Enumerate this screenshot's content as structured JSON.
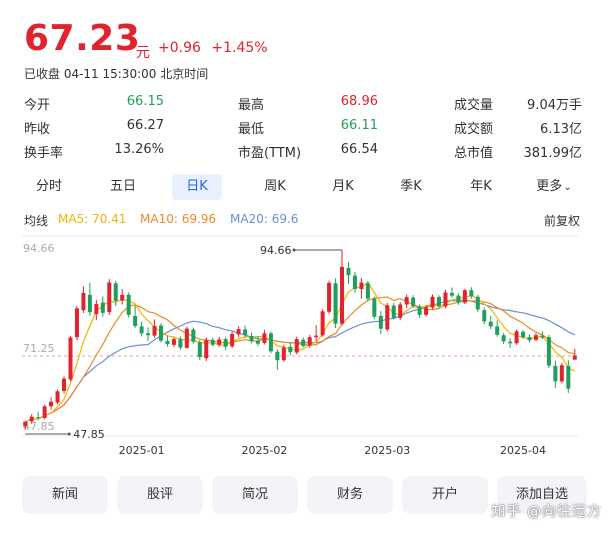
{
  "quote": {
    "price": "67.23",
    "unit": "元",
    "change": "+0.96",
    "change_pct": "+1.45%",
    "status": "已收盘 04-11 15:30:00 北京时间"
  },
  "stats": [
    [
      {
        "label": "今开",
        "value": "66.15",
        "tone": "green"
      },
      {
        "label": "最高",
        "value": "68.96",
        "tone": "red"
      },
      {
        "label": "成交量",
        "value": "9.04万手",
        "tone": "plain"
      }
    ],
    [
      {
        "label": "昨收",
        "value": "66.27",
        "tone": "plain"
      },
      {
        "label": "最低",
        "value": "66.11",
        "tone": "green"
      },
      {
        "label": "成交额",
        "value": "6.13亿",
        "tone": "plain"
      }
    ],
    [
      {
        "label": "换手率",
        "value": "13.26%",
        "tone": "plain"
      },
      {
        "label": "市盈(TTM)",
        "value": "66.54",
        "tone": "plain"
      },
      {
        "label": "总市值",
        "value": "381.99亿",
        "tone": "plain"
      }
    ]
  ],
  "tabs": [
    {
      "label": "分时"
    },
    {
      "label": "五日"
    },
    {
      "label": "日K",
      "active": true
    },
    {
      "label": "周K"
    },
    {
      "label": "月K"
    },
    {
      "label": "季K"
    },
    {
      "label": "年K"
    },
    {
      "label": "更多"
    }
  ],
  "ma": {
    "title": "均线",
    "ma5": "MA5: 70.41",
    "ma10": "MA10: 69.96",
    "ma20": "MA20: 69.6",
    "adjust": "前复权"
  },
  "colors": {
    "up": "#e0242d",
    "down": "#1f9f5c",
    "ma5": "#f4b400",
    "ma10": "#f08a24",
    "ma20": "#6b8fd6",
    "accent": "#1f6ad9"
  },
  "chart_data": {
    "type": "candlestick",
    "y_axis_labels": [
      "94.66",
      "71.25",
      "47.85"
    ],
    "ref_line": "71.25",
    "high_annotation": "94.66",
    "low_annotation": "47.85",
    "ylim": [
      47.85,
      94.66
    ],
    "x_ticks": [
      "2025-01",
      "2025-02",
      "2025-03",
      "2025-04"
    ],
    "x_tick_index": [
      18,
      37,
      56,
      77
    ],
    "high_index": 49,
    "low_index": 0,
    "candles": [
      [
        48.8,
        50.2,
        47.85,
        50.0
      ],
      [
        50.1,
        52.0,
        49.5,
        51.3
      ],
      [
        51.2,
        52.6,
        50.4,
        51.0
      ],
      [
        51.0,
        54.4,
        50.6,
        54.0
      ],
      [
        54.0,
        56.3,
        53.2,
        55.2
      ],
      [
        55.0,
        58.4,
        54.5,
        57.9
      ],
      [
        58.0,
        61.8,
        57.3,
        61.2
      ],
      [
        61.0,
        72.3,
        60.5,
        71.9
      ],
      [
        72.0,
        80.1,
        71.2,
        79.5
      ],
      [
        79.0,
        85.2,
        78.3,
        83.5
      ],
      [
        83.0,
        86.1,
        77.5,
        78.5
      ],
      [
        78.0,
        81.7,
        76.4,
        80.6
      ],
      [
        81.0,
        82.6,
        77.3,
        78.3
      ],
      [
        78.5,
        87.1,
        77.8,
        86.2
      ],
      [
        86.0,
        86.7,
        80.1,
        81.4
      ],
      [
        81.5,
        84.5,
        80.5,
        83.0
      ],
      [
        83.0,
        83.6,
        77.1,
        77.8
      ],
      [
        77.5,
        80.2,
        74.4,
        74.9
      ],
      [
        74.8,
        76.0,
        72.2,
        73.0
      ],
      [
        73.0,
        74.5,
        71.0,
        72.5
      ],
      [
        72.4,
        76.6,
        71.8,
        74.9
      ],
      [
        75.0,
        75.6,
        70.6,
        71.1
      ],
      [
        71.0,
        72.4,
        69.5,
        70.2
      ],
      [
        70.0,
        71.9,
        69.4,
        71.5
      ],
      [
        71.5,
        72.2,
        68.7,
        69.3
      ],
      [
        69.2,
        74.8,
        69.0,
        74.2
      ],
      [
        74.0,
        74.5,
        70.3,
        70.8
      ],
      [
        70.7,
        71.2,
        66.0,
        66.8
      ],
      [
        66.5,
        72.0,
        65.8,
        71.2
      ],
      [
        71.3,
        71.9,
        69.6,
        70.0
      ],
      [
        70.0,
        72.1,
        69.4,
        71.4
      ],
      [
        71.5,
        72.0,
        68.6,
        69.5
      ],
      [
        69.6,
        73.4,
        69.2,
        72.8
      ],
      [
        72.7,
        74.8,
        72.0,
        74.1
      ],
      [
        74.0,
        75.0,
        71.9,
        72.5
      ],
      [
        72.3,
        73.2,
        70.4,
        71.0
      ],
      [
        71.0,
        72.3,
        69.7,
        70.3
      ],
      [
        70.5,
        73.9,
        70.1,
        73.0
      ],
      [
        73.0,
        73.5,
        67.8,
        68.3
      ],
      [
        68.2,
        68.8,
        63.5,
        66.0
      ],
      [
        66.0,
        70.0,
        65.6,
        69.3
      ],
      [
        69.5,
        70.6,
        67.3,
        68.1
      ],
      [
        68.0,
        72.1,
        67.5,
        71.5
      ],
      [
        71.3,
        71.9,
        69.3,
        69.7
      ],
      [
        69.8,
        72.6,
        69.2,
        72.0
      ],
      [
        72.0,
        75.1,
        70.9,
        72.4
      ],
      [
        72.5,
        79.3,
        72.1,
        78.7
      ],
      [
        78.6,
        86.7,
        78.0,
        86.1
      ],
      [
        86.0,
        87.3,
        74.4,
        75.5
      ],
      [
        75.5,
        94.66,
        75.0,
        90.3
      ],
      [
        90.0,
        91.5,
        85.8,
        88.1
      ],
      [
        88.0,
        88.9,
        83.6,
        84.5
      ],
      [
        84.5,
        87.4,
        82.0,
        86.2
      ],
      [
        86.0,
        86.6,
        81.3,
        82.0
      ],
      [
        82.0,
        82.5,
        76.7,
        77.3
      ],
      [
        77.5,
        78.8,
        72.8,
        74.2
      ],
      [
        74.0,
        80.9,
        73.5,
        80.3
      ],
      [
        80.2,
        80.9,
        76.6,
        77.0
      ],
      [
        77.0,
        81.1,
        76.4,
        80.5
      ],
      [
        80.5,
        83.1,
        79.5,
        82.4
      ],
      [
        82.3,
        82.9,
        79.6,
        80.1
      ],
      [
        80.0,
        80.5,
        77.0,
        77.8
      ],
      [
        77.8,
        80.4,
        77.3,
        79.7
      ],
      [
        79.7,
        83.1,
        79.2,
        82.5
      ],
      [
        82.4,
        82.9,
        79.6,
        80.0
      ],
      [
        80.0,
        84.3,
        79.5,
        83.6
      ],
      [
        83.5,
        84.9,
        82.2,
        82.8
      ],
      [
        82.8,
        83.4,
        80.4,
        81.1
      ],
      [
        81.0,
        84.6,
        80.6,
        84.2
      ],
      [
        84.2,
        85.0,
        82.0,
        82.6
      ],
      [
        82.5,
        83.0,
        78.6,
        79.2
      ],
      [
        79.0,
        79.7,
        75.4,
        76.1
      ],
      [
        76.0,
        77.5,
        74.1,
        74.8
      ],
      [
        74.8,
        76.4,
        72.1,
        72.6
      ],
      [
        72.5,
        73.1,
        70.2,
        70.9
      ],
      [
        70.8,
        71.7,
        69.2,
        70.4
      ],
      [
        70.4,
        74.0,
        70.0,
        73.5
      ],
      [
        73.4,
        73.8,
        71.6,
        72.0
      ],
      [
        72.0,
        72.7,
        70.6,
        71.2
      ],
      [
        71.3,
        73.0,
        70.9,
        72.5
      ],
      [
        72.4,
        73.5,
        71.5,
        71.9
      ],
      [
        72.0,
        72.6,
        64.0,
        64.6
      ],
      [
        64.5,
        65.9,
        58.8,
        60.5
      ],
      [
        60.5,
        65.3,
        60.0,
        64.7
      ],
      [
        64.5,
        66.0,
        57.5,
        58.6
      ],
      [
        66.15,
        68.96,
        66.11,
        67.23
      ]
    ]
  },
  "buttons": [
    "新闻",
    "股评",
    "简况",
    "财务",
    "开户",
    "添加自选"
  ],
  "watermark": "知乎 @向往远方"
}
